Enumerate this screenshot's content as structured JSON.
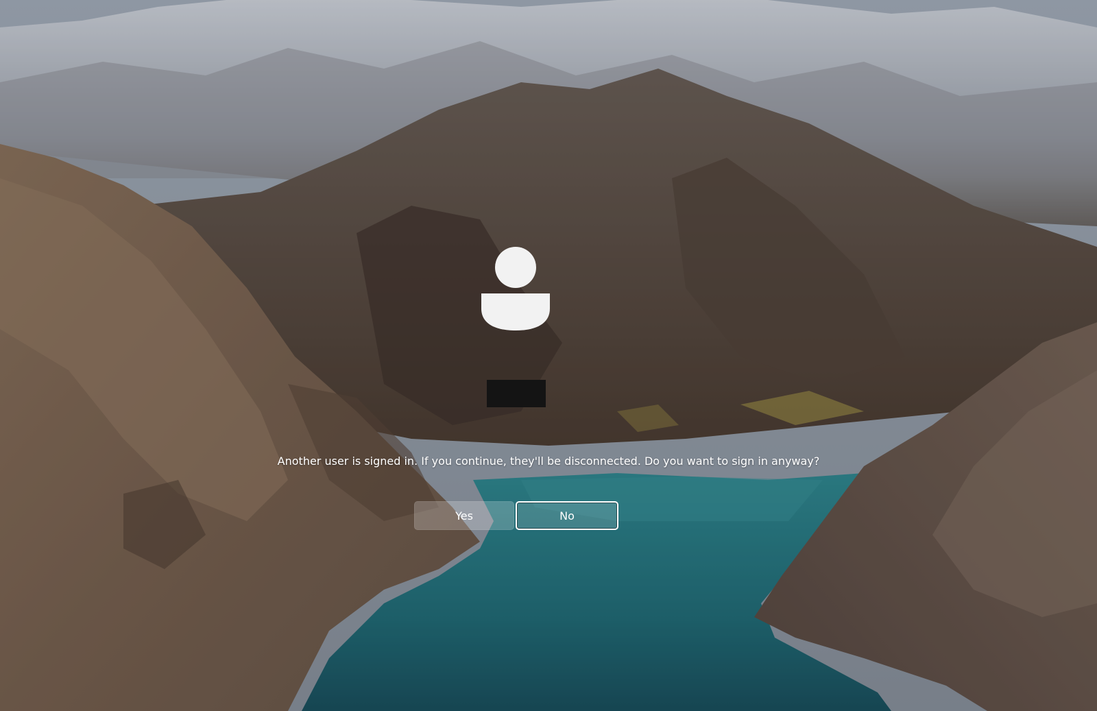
{
  "lock_screen": {
    "background_image": "mountain-lake-wallpaper",
    "avatar_icon": "default-user-icon",
    "message": "Another user is signed in. If you continue, they'll be disconnected. Do you want to sign in anyway?",
    "buttons": {
      "yes_label": "Yes",
      "no_label": "No"
    }
  },
  "colors": {
    "button_focus_border": "#ffffff",
    "redacted_username": "#141414"
  }
}
